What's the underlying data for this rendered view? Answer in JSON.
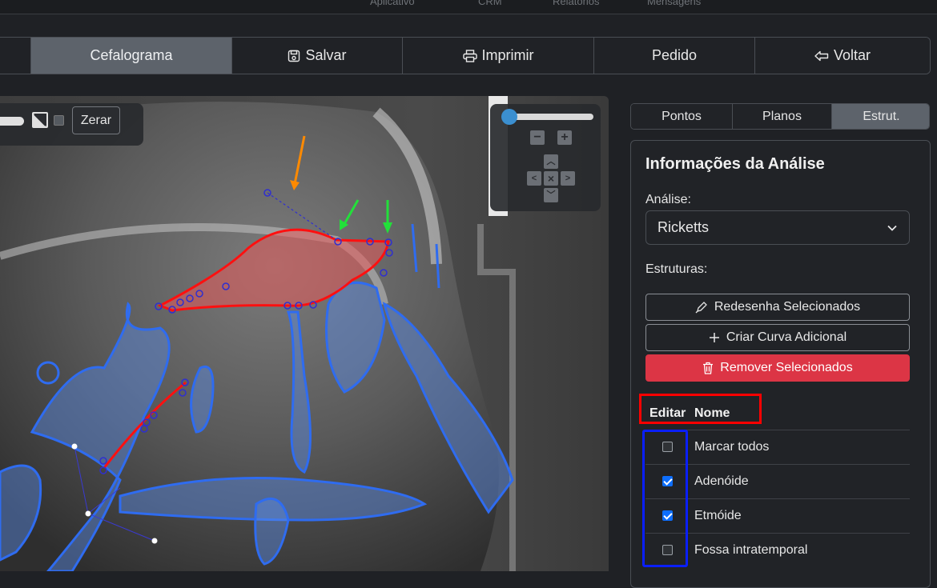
{
  "topnav": {
    "items": [
      "Aplicativo",
      "CRM",
      "Relatórios",
      "Mensagens"
    ]
  },
  "toolbar": {
    "cefalograma": "Cefalograma",
    "salvar": "Salvar",
    "imprimir": "Imprimir",
    "pedido": "Pedido",
    "voltar": "Voltar"
  },
  "viewer": {
    "zerar": "Zerar",
    "zoom_level": 0.02
  },
  "tabs": [
    "Pontos",
    "Planos",
    "Estrut."
  ],
  "panel": {
    "title": "Informações da Análise",
    "analise_label": "Análise:",
    "analise_value": "Ricketts",
    "estruturas_label": "Estruturas:",
    "redesenha": "Redesenha Selecionados",
    "criar": "Criar Curva Adicional",
    "remover": "Remover Selecionados",
    "col_editar": "Editar",
    "col_nome": "Nome",
    "rows": [
      {
        "name": "Marcar todos",
        "checked": false
      },
      {
        "name": "Adenóide",
        "checked": true
      },
      {
        "name": "Etmóide",
        "checked": true
      },
      {
        "name": "Fossa intratemporal",
        "checked": false
      }
    ]
  },
  "colors": {
    "accent": "#dc3545",
    "active": "#5d636b",
    "check": "#0d6efd"
  }
}
